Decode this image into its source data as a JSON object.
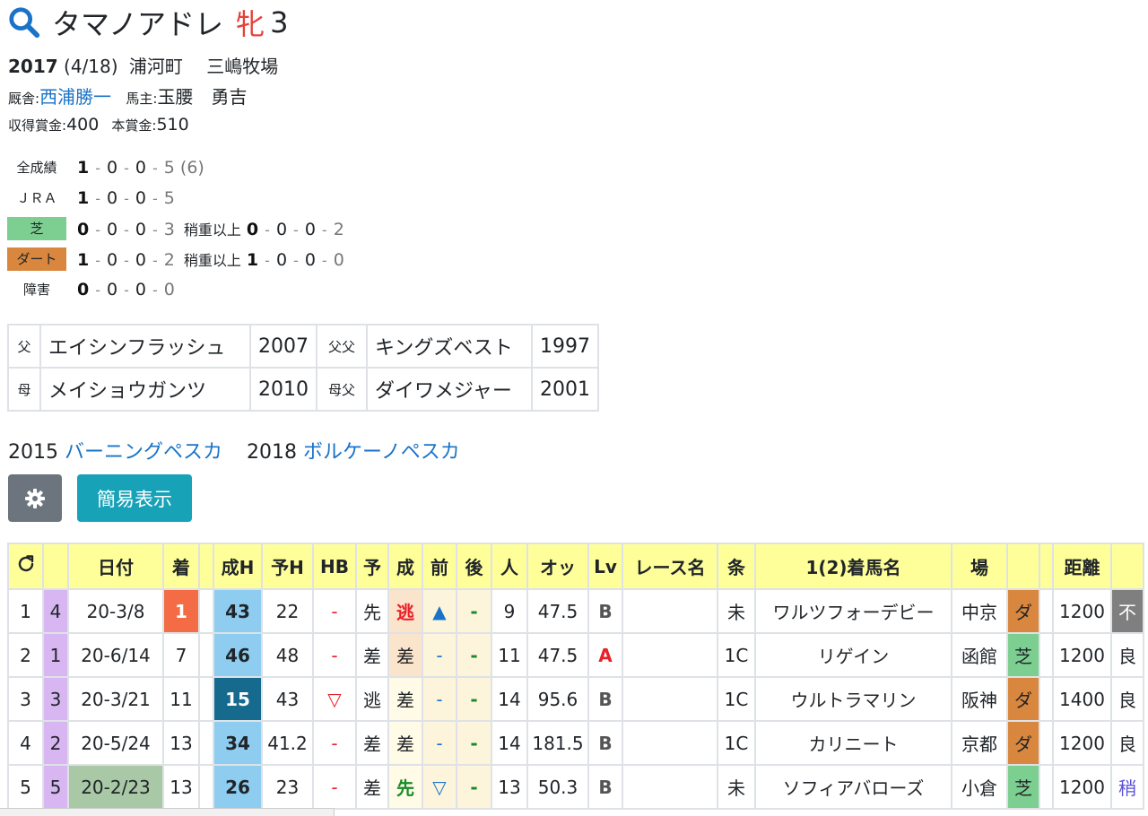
{
  "horse": {
    "name": "タマノアドレ",
    "sex": "牝",
    "age": "3"
  },
  "profile": {
    "birth_year": "2017",
    "birth_date": "(4/18)",
    "region": "浦河町",
    "breeder": "三嶋牧場",
    "trainer_label": "厩舎:",
    "trainer": "西浦勝一",
    "owner_label": "馬主:",
    "owner": "玉腰　勇吉",
    "earned_label": "収得賞金:",
    "earned": "400",
    "prize_label": "本賞金:",
    "prize": "510"
  },
  "record": {
    "all": {
      "label": "全成績",
      "w": "1",
      "p2": "0",
      "p3": "0",
      "o": "5",
      "extra": "(6)"
    },
    "jra": {
      "label": "ＪＲＡ",
      "w": "1",
      "p2": "0",
      "p3": "0",
      "o": "5"
    },
    "turf": {
      "label": "芝",
      "w": "0",
      "p2": "0",
      "p3": "0",
      "o": "3",
      "sub_label": "稍重以上",
      "sw": "0",
      "sp2": "0",
      "sp3": "0",
      "so": "2"
    },
    "dirt": {
      "label": "ダート",
      "w": "1",
      "p2": "0",
      "p3": "0",
      "o": "2",
      "sub_label": "稍重以上",
      "sw": "1",
      "sp2": "0",
      "sp3": "0",
      "so": "0"
    },
    "jump": {
      "label": "障害",
      "w": "0",
      "p2": "0",
      "p3": "0",
      "o": "0"
    }
  },
  "pedigree": {
    "sire_label": "父",
    "sire": "エイシンフラッシュ",
    "sire_year": "2007",
    "sire_sire_label": "父父",
    "sire_sire": "キングズベスト",
    "sire_sire_year": "1997",
    "dam_label": "母",
    "dam": "メイショウガンツ",
    "dam_year": "2010",
    "dam_sire_label": "母父",
    "dam_sire": "ダイワメジャー",
    "dam_sire_year": "2001"
  },
  "siblings": [
    {
      "year": "2015",
      "name": "バーニングペスカ"
    },
    {
      "year": "2018",
      "name": "ボルケーノペスカ"
    }
  ],
  "buttons": {
    "simple": "簡易表示"
  },
  "race_table": {
    "headers": [
      "日付",
      "着",
      "成H",
      "予H",
      "HB",
      "予",
      "成",
      "前",
      "後",
      "人",
      "オッ",
      "Lv",
      "レース名",
      "条",
      "1(2)着馬名",
      "場",
      "距離"
    ],
    "rows": [
      {
        "no": "1",
        "waku": "4",
        "date": "20-3/8",
        "pos": "1",
        "sh": "43",
        "yh": "22",
        "hb": "-",
        "pre": "先",
        "res": "逃",
        "front": "▲",
        "back": "-",
        "fav": "9",
        "odds": "47.5",
        "lv": "B",
        "race": "",
        "cls": "未",
        "winner": "ワルツフォーデビー",
        "course": "中京",
        "surf": "ダ",
        "dist": "1200",
        "cond": "不"
      },
      {
        "no": "2",
        "waku": "1",
        "date": "20-6/14",
        "pos": "7",
        "sh": "46",
        "yh": "48",
        "hb": "-",
        "pre": "差",
        "res": "差",
        "front": "-",
        "back": "-",
        "fav": "11",
        "odds": "47.5",
        "lv": "A",
        "race": "",
        "cls": "1C",
        "winner": "リゲイン",
        "course": "函館",
        "surf": "芝",
        "dist": "1200",
        "cond": "良"
      },
      {
        "no": "3",
        "waku": "3",
        "date": "20-3/21",
        "pos": "11",
        "sh": "15",
        "yh": "43",
        "hb": "▽",
        "pre": "逃",
        "res": "差",
        "front": "-",
        "back": "-",
        "fav": "14",
        "odds": "95.6",
        "lv": "B",
        "race": "",
        "cls": "1C",
        "winner": "ウルトラマリン",
        "course": "阪神",
        "surf": "ダ",
        "dist": "1400",
        "cond": "良"
      },
      {
        "no": "4",
        "waku": "2",
        "date": "20-5/24",
        "pos": "13",
        "sh": "34",
        "yh": "41.2",
        "hb": "-",
        "pre": "差",
        "res": "差",
        "front": "-",
        "back": "-",
        "fav": "14",
        "odds": "181.5",
        "lv": "B",
        "race": "",
        "cls": "1C",
        "winner": "カリニート",
        "course": "京都",
        "surf": "ダ",
        "dist": "1200",
        "cond": "良"
      },
      {
        "no": "5",
        "waku": "5",
        "date": "20-2/23",
        "pos": "13",
        "sh": "26",
        "yh": "23",
        "hb": "-",
        "pre": "差",
        "res": "先",
        "front": "▽",
        "back": "-",
        "fav": "13",
        "odds": "50.3",
        "lv": "B",
        "race": "",
        "cls": "未",
        "winner": "ソフィアバローズ",
        "course": "小倉",
        "surf": "芝",
        "dist": "1200",
        "cond": "稍"
      }
    ]
  },
  "colors": {
    "accent": "#1a73c8",
    "turf": "#7ccf90",
    "dirt": "#d9873f",
    "header": "#ffff99",
    "win": "#f36c46"
  }
}
